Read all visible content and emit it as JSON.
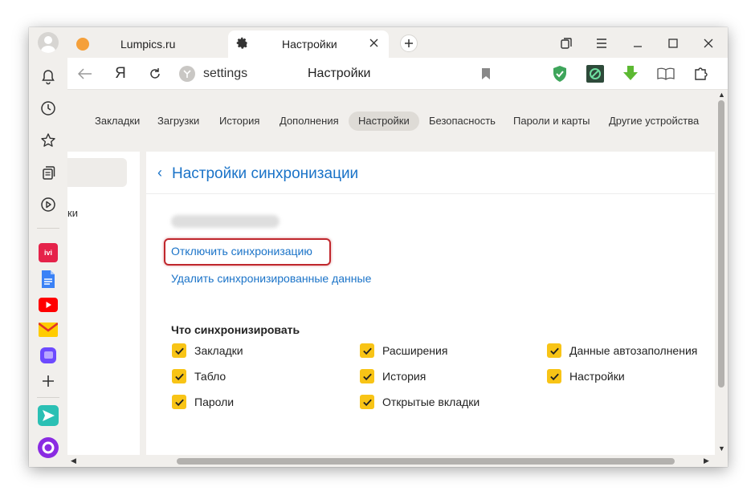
{
  "tabs": [
    {
      "title": "Lumpics.ru",
      "active": false
    },
    {
      "title": "Настройки",
      "active": true
    }
  ],
  "toolbar": {
    "yandex_letter": "Я",
    "address": "settings",
    "center_title": "Настройки"
  },
  "topnav": [
    {
      "label": "Закладки",
      "active": false
    },
    {
      "label": "Загрузки",
      "active": false
    },
    {
      "label": "История",
      "active": false
    },
    {
      "label": "Дополнения",
      "active": false
    },
    {
      "label": "Настройки",
      "active": true
    },
    {
      "label": "Безопасность",
      "active": false
    },
    {
      "label": "Пароли и карты",
      "active": false
    },
    {
      "label": "Другие устройства",
      "active": false
    }
  ],
  "sidepanel": {
    "partial_text": "ки"
  },
  "main": {
    "back_icon": "‹",
    "title": "Настройки синхронизации",
    "disable_sync_link": "Отключить синхронизацию",
    "delete_data_link": "Удалить синхронизированные данные",
    "section_heading": "Что синхронизировать",
    "checkboxes": [
      {
        "label": "Закладки",
        "checked": true
      },
      {
        "label": "Расширения",
        "checked": true
      },
      {
        "label": "Данные автозаполнения",
        "checked": true
      },
      {
        "label": "Табло",
        "checked": true
      },
      {
        "label": "История",
        "checked": true
      },
      {
        "label": "Настройки",
        "checked": true
      },
      {
        "label": "Пароли",
        "checked": true
      },
      {
        "label": "Открытые вкладки",
        "checked": true
      }
    ]
  },
  "leftbar_services": [
    {
      "name": "ivi",
      "icon": "ivi-icon",
      "color": "#e5224a",
      "text": "ivi"
    },
    {
      "name": "docs",
      "icon": "docs-icon",
      "color": "#3b82f6"
    },
    {
      "name": "youtube",
      "icon": "youtube-icon",
      "color": "#ff0000"
    },
    {
      "name": "mail",
      "icon": "mail-icon",
      "color": "#ffcc00"
    },
    {
      "name": "messenger",
      "icon": "messenger-icon",
      "color": "#6d4aff"
    }
  ],
  "colors": {
    "accent": "#1a73c8",
    "checkbox": "#f8c416",
    "highlight": "#c0272d"
  }
}
